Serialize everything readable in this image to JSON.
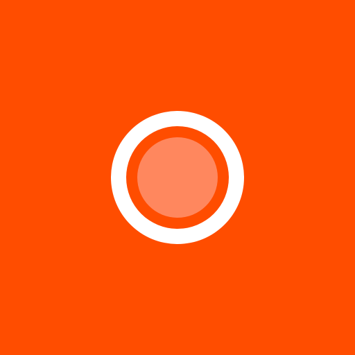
{
  "colors": {
    "background": "#FF4D00",
    "ring": "#FFFFFF",
    "dot": "#FF875E"
  },
  "icon": {
    "name": "record-icon"
  }
}
